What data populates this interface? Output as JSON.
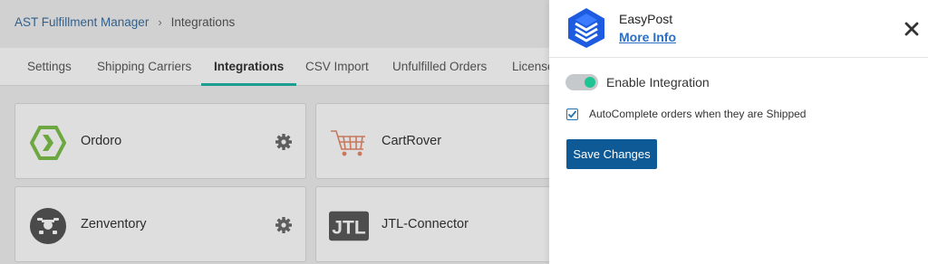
{
  "breadcrumb": {
    "parent": "AST Fulfillment Manager",
    "separator": "›",
    "current": "Integrations"
  },
  "tabs": [
    {
      "label": "Settings"
    },
    {
      "label": "Shipping Carriers"
    },
    {
      "label": "Integrations",
      "active": true
    },
    {
      "label": "CSV Import"
    },
    {
      "label": "Unfulfilled Orders"
    },
    {
      "label": "License"
    }
  ],
  "integrations": [
    {
      "name": "Ordoro",
      "icon": "ordoro-logo",
      "settings_icon": "gear-icon"
    },
    {
      "name": "CartRover",
      "icon": "cartrover-cart-logo"
    },
    {
      "name": "Zenventory",
      "icon": "zenventory-logo",
      "settings_icon": "gear-icon"
    },
    {
      "name": "JTL-Connector",
      "icon": "jtl-logo"
    }
  ],
  "jtl_logo_text": "JTL",
  "panel": {
    "title": "EasyPost",
    "link": "More Info",
    "toggle_label": "Enable Integration",
    "toggle_on": true,
    "checkbox_label": "AutoComplete orders when they are Shipped",
    "checkbox_checked": true,
    "save_label": "Save Changes"
  },
  "colors": {
    "accent_tab": "#1fb6a6",
    "toggle_knob": "#1ec494",
    "save_button": "#0e5a96",
    "link": "#2a6fc3",
    "easypost_blue": "#1d5be0"
  }
}
